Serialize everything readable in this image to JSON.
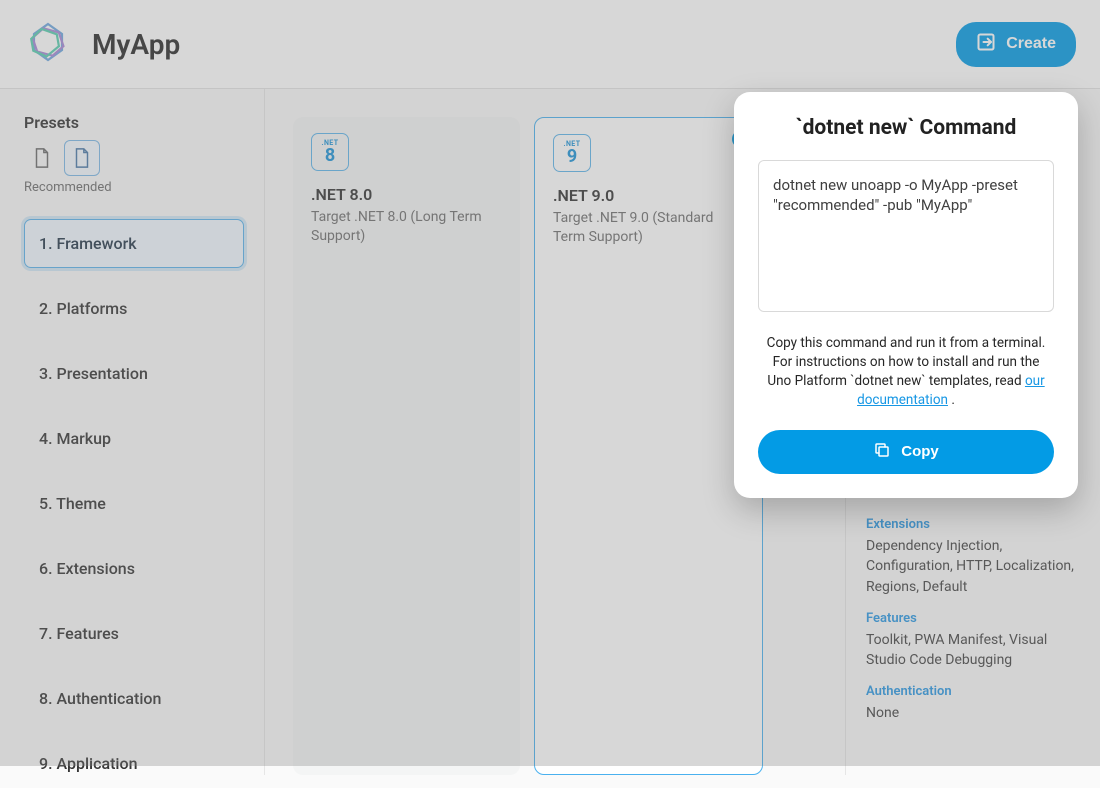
{
  "header": {
    "appName": "MyApp",
    "createLabel": "Create"
  },
  "sidebar": {
    "presetsLabel": "Presets",
    "presetSubLabel": "Recommended",
    "steps": [
      "1. Framework",
      "2. Platforms",
      "3. Presentation",
      "4. Markup",
      "5. Theme",
      "6. Extensions",
      "7. Features",
      "8. Authentication",
      "9. Application"
    ]
  },
  "frameworks": [
    {
      "badgeTop": ".NET",
      "badgeVer": "8",
      "title": ".NET 8.0",
      "sub": "Target .NET 8.0 (Long Term Support)"
    },
    {
      "badgeTop": ".NET",
      "badgeVer": "9",
      "title": ".NET 9.0",
      "sub": "Target .NET 9.0 (Standard Term Support)"
    }
  ],
  "summary": [
    {
      "title": "Extensions",
      "body": "Dependency Injection, Configuration, HTTP, Localization, Regions, Default"
    },
    {
      "title": "Features",
      "body": "Toolkit, PWA Manifest, Visual Studio Code Debugging"
    },
    {
      "title": "Authentication",
      "body": "None"
    }
  ],
  "popover": {
    "title": "`dotnet new` Command",
    "command": "dotnet new unoapp -o MyApp -preset \"recommended\" -pub \"MyApp\"",
    "helpBefore": "Copy this command and run it from a terminal. For instructions on how to install and run the Uno Platform `dotnet new` templates, read ",
    "helpLink": "our documentation",
    "helpAfter": " .",
    "copyLabel": "Copy"
  }
}
